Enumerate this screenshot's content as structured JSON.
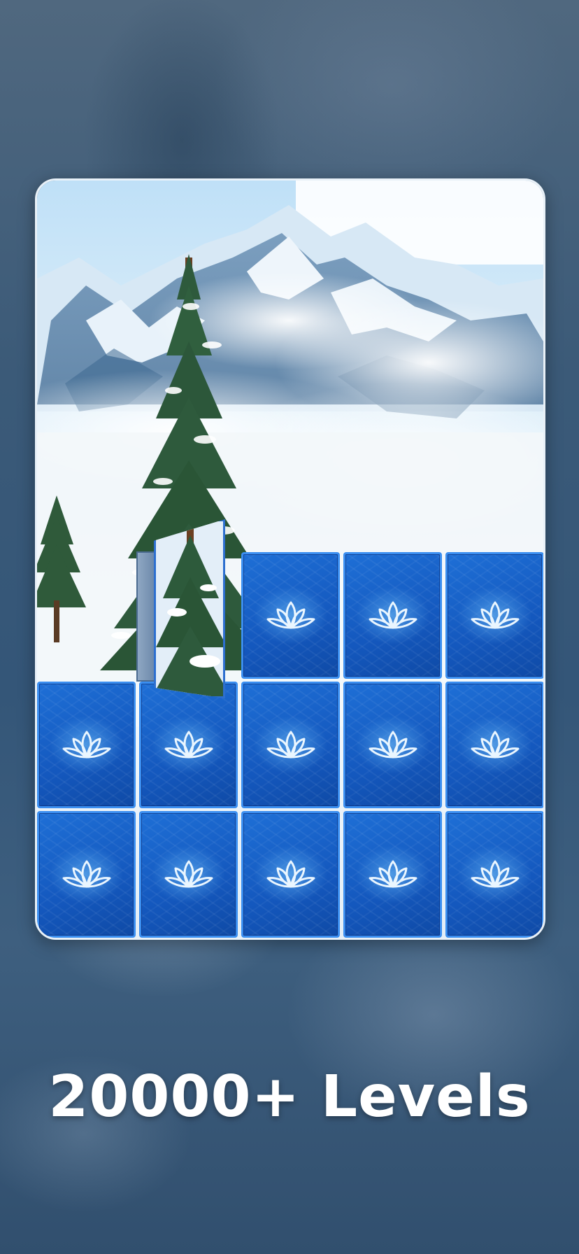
{
  "promo": {
    "caption": "20000+ Levels"
  },
  "board": {
    "rows": 3,
    "columns": 5,
    "tile_icon": "lotus-icon",
    "revealed_tiles": 2,
    "flipping_tiles": 1
  },
  "colors": {
    "tile_face": "#1458be",
    "tile_border": "#3a8ef0",
    "caption_text": "#ffffff",
    "card_border": "#e9f1f8"
  }
}
